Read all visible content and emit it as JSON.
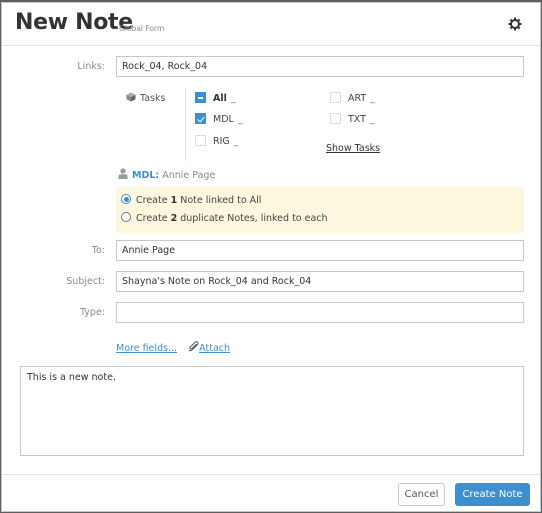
{
  "header": {
    "title": "New Note",
    "subtitle": "- Global Form",
    "settings_icon": "gear-icon"
  },
  "form": {
    "links": {
      "label": "Links:",
      "value": "Rock_04, Rock_04"
    },
    "tasks": {
      "label": "Tasks",
      "icon": "cube-icon",
      "items": [
        {
          "label": "All",
          "state": "partial",
          "suffix": "_"
        },
        {
          "label": "MDL",
          "state": "checked",
          "suffix": "_"
        },
        {
          "label": "RIG",
          "state": "unchecked",
          "suffix": "_"
        },
        {
          "label": "ART",
          "state": "unchecked",
          "suffix": "_"
        },
        {
          "label": "TXT",
          "state": "unchecked",
          "suffix": "_"
        }
      ],
      "show_tasks_label": "Show Tasks"
    },
    "assignee": {
      "icon": "person-icon",
      "role": "MDL:",
      "name": "Annie Page"
    },
    "note_options": [
      {
        "prefix": "Create ",
        "count": "1",
        "suffix": " Note linked to All",
        "selected": true
      },
      {
        "prefix": "Create ",
        "count": "2",
        "suffix": " duplicate Notes, linked to each",
        "selected": false
      }
    ],
    "to": {
      "label": "To:",
      "value": "Annie Page"
    },
    "subject": {
      "label": "Subject:",
      "value": "Shayna's Note on Rock_04 and Rock_04"
    },
    "type": {
      "label": "Type:",
      "value": ""
    },
    "more_fields_label": "More fields...",
    "attach_label": "Attach",
    "body": "This is a new note."
  },
  "footer": {
    "cancel_label": "Cancel",
    "create_label": "Create Note"
  },
  "colors": {
    "accent": "#3e8fd0",
    "notice_bg": "#fdf7df"
  }
}
